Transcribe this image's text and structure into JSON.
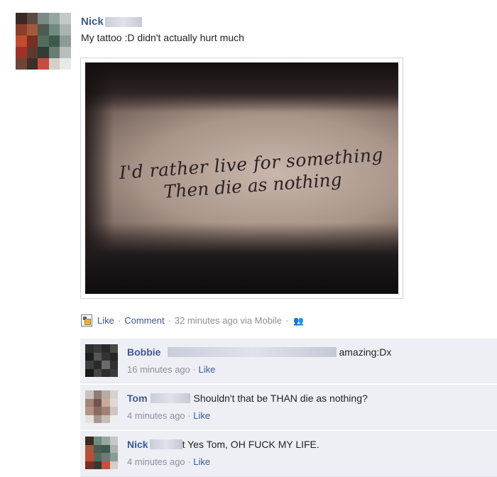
{
  "post": {
    "author": "Nick",
    "text": "My tattoo :D didn't actually hurt much",
    "photo": {
      "tattoo_line1": "I'd rather live for something",
      "tattoo_line2": "Then die as nothing"
    },
    "actions": {
      "like": "Like",
      "comment": "Comment",
      "timestamp": "32 minutes ago via Mobile"
    }
  },
  "comments": [
    {
      "author": "Bobbie",
      "text": "amazing:Dx",
      "time": "16 minutes ago",
      "like": "Like"
    },
    {
      "author": "Tom",
      "text": "Shouldn't that be THAN die as nothing?",
      "time": "4 minutes ago",
      "like": "Like"
    },
    {
      "author": "Nick",
      "text": "t Yes Tom, OH FUCK MY LIFE.",
      "time": "4 minutes ago",
      "like": "Like"
    }
  ],
  "colors": {
    "link": "#3b5998",
    "comment_bg": "#edeff4",
    "meta_text": "#8a8f99"
  }
}
